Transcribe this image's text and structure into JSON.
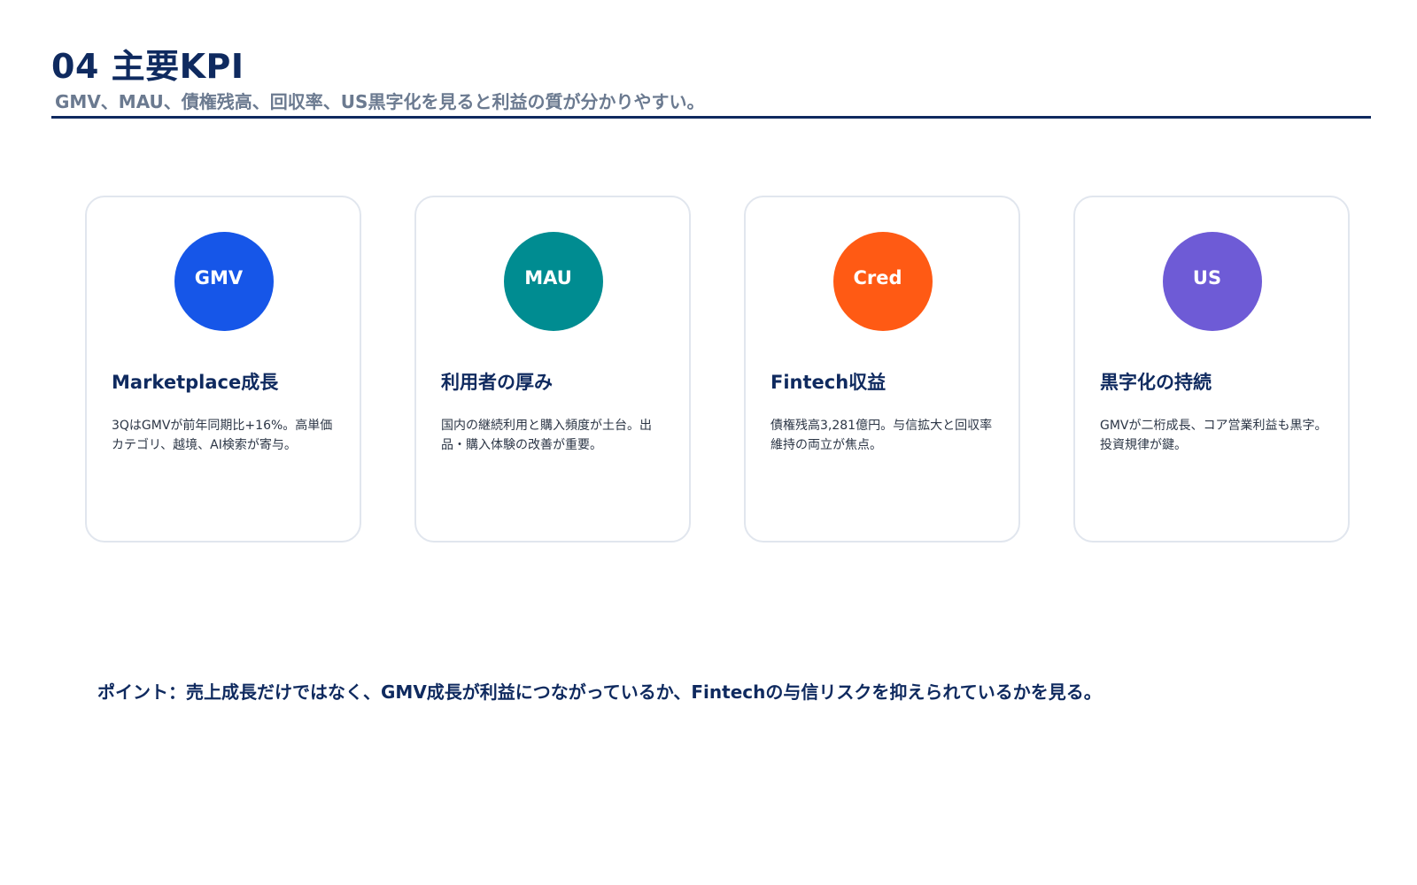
{
  "header": {
    "title": "04 主要KPI",
    "subtitle": "GMV、MAU、債権残高、回収率、US黒字化を見ると利益の質が分かりやすい。"
  },
  "cards": [
    {
      "badge": "GMV",
      "badge_color": "#1656e8",
      "title": "Marketplace成長",
      "body": "3QはGMVが前年同期比+16%。高単価カテゴリ、越境、AI検索が寄与。"
    },
    {
      "badge": "MAU",
      "badge_color": "#008c91",
      "title": "利用者の厚み",
      "body": "国内の継続利用と購入頻度が土台。出品・購入体験の改善が重要。"
    },
    {
      "badge": "Cred",
      "badge_color": "#ff5a14",
      "title": "Fintech収益",
      "body": "債権残高3,281億円。与信拡大と回収率維持の両立が焦点。"
    },
    {
      "badge": "US",
      "badge_color": "#6e5bd6",
      "title": "黒字化の持続",
      "body": "GMVが二桁成長、コア営業利益も黒字。投資規律が鍵。"
    }
  ],
  "footer": {
    "point": "ポイント：売上成長だけではなく、GMV成長が利益につながっているか、Fintechの与信リスクを抑えられているかを見る。"
  }
}
